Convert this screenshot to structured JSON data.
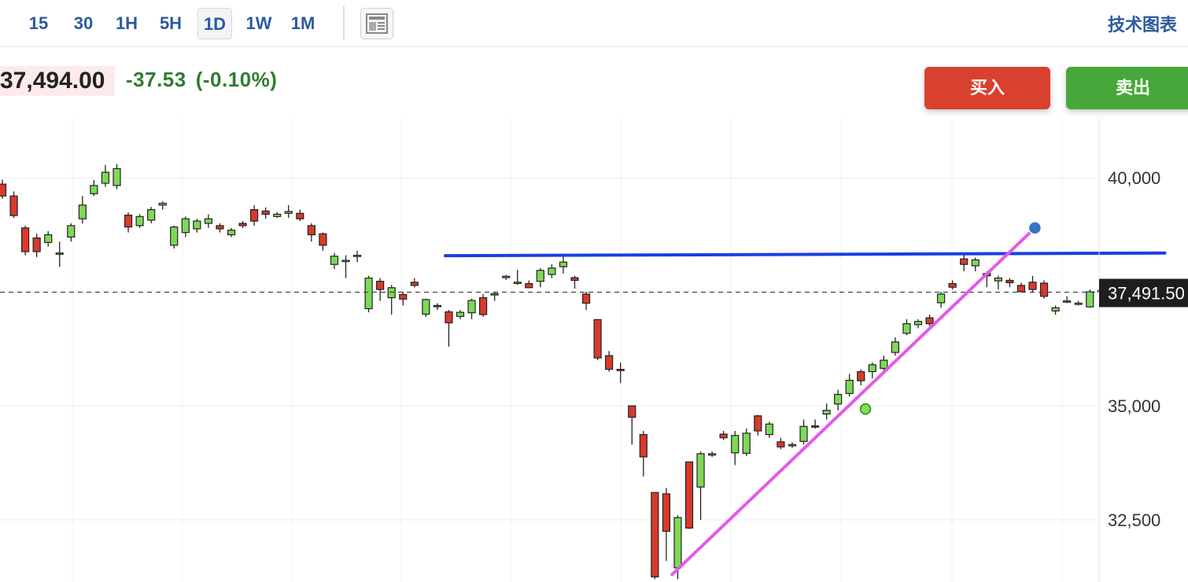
{
  "toolbar": {
    "timeframes": [
      "15",
      "30",
      "1H",
      "5H",
      "1D",
      "1W",
      "1M"
    ],
    "active_timeframe": "1D",
    "layout_icon": "layout-icon",
    "technical_link": "技术图表"
  },
  "quote": {
    "price": "37,494.00",
    "change": "-37.53",
    "change_pct": "(-0.10%)"
  },
  "actions": {
    "buy": "买入",
    "sell": "卖出"
  },
  "colors": {
    "up": "#7ed957",
    "down": "#d83a2c",
    "horizontal_line": "#1a3fe0",
    "trend_line": "#e35be8",
    "price_tag_bg": "#1e1e1e",
    "handle_blue": "#3a72c9",
    "handle_green": "#7ee04a"
  },
  "chart_data": {
    "type": "candlestick",
    "y_ticks": [
      {
        "value": 40000,
        "label": "40,000"
      },
      {
        "value": 35000,
        "label": "35,000"
      },
      {
        "value": 32500,
        "label": "32,500"
      }
    ],
    "ylim": [
      31300,
      41300
    ],
    "last_price": 37491.5,
    "last_price_label": "37,491.50",
    "horizontal_line": {
      "from_index": 40,
      "to_index": 101,
      "value": 38290,
      "end_value": 38350
    },
    "trend_line": {
      "from_index": 58.5,
      "to_index": 90.2,
      "from_value": 31300,
      "to_value": 38900
    },
    "trend_handles": [
      {
        "index": 90.2,
        "value": 38900,
        "color": "blue"
      },
      {
        "index": 75.4,
        "value": 34930,
        "color": "green"
      }
    ],
    "candles": [
      [
        39860,
        39600,
        39960,
        39540
      ],
      [
        39600,
        39170,
        39700,
        39120
      ],
      [
        38900,
        38380,
        38950,
        38300
      ],
      [
        38680,
        38380,
        38770,
        38260
      ],
      [
        38580,
        38750,
        38830,
        38490
      ],
      [
        38330,
        38350,
        38600,
        38050
      ],
      [
        38700,
        38950,
        39000,
        38600
      ],
      [
        39100,
        39400,
        39600,
        39000
      ],
      [
        39650,
        39830,
        39950,
        39600
      ],
      [
        39880,
        40120,
        40280,
        39800
      ],
      [
        39830,
        40200,
        40300,
        39750
      ],
      [
        39180,
        38920,
        39240,
        38800
      ],
      [
        38950,
        39150,
        39200,
        38900
      ],
      [
        39070,
        39300,
        39360,
        39000
      ],
      [
        39400,
        39440,
        39480,
        39300
      ],
      [
        38520,
        38920,
        38950,
        38450
      ],
      [
        38800,
        39100,
        39150,
        38700
      ],
      [
        38880,
        39050,
        39100,
        38800
      ],
      [
        39000,
        39100,
        39200,
        38900
      ],
      [
        38950,
        38880,
        39000,
        38800
      ],
      [
        38750,
        38850,
        38900,
        38700
      ],
      [
        39000,
        38950,
        39050,
        38900
      ],
      [
        39300,
        39050,
        39400,
        38950
      ],
      [
        39270,
        39200,
        39350,
        39100
      ],
      [
        39150,
        39200,
        39250,
        39120
      ],
      [
        39220,
        39260,
        39400,
        39120
      ],
      [
        39220,
        39100,
        39300,
        39050
      ],
      [
        38950,
        38750,
        39000,
        38600
      ],
      [
        38770,
        38520,
        38800,
        38400
      ],
      [
        38100,
        38280,
        38350,
        38000
      ],
      [
        38180,
        38190,
        38300,
        37800
      ],
      [
        38290,
        38300,
        38400,
        38150
      ],
      [
        37130,
        37800,
        37850,
        37050
      ],
      [
        37730,
        37550,
        37800,
        37300
      ],
      [
        37370,
        37590,
        37650,
        37000
      ],
      [
        37440,
        37340,
        37500,
        37200
      ],
      [
        37710,
        37640,
        37800,
        37600
      ],
      [
        37010,
        37330,
        37350,
        36950
      ],
      [
        37200,
        37180,
        37250,
        37100
      ],
      [
        37060,
        36820,
        37100,
        36300
      ],
      [
        36960,
        37050,
        37100,
        36900
      ],
      [
        37040,
        37310,
        37350,
        36900
      ],
      [
        37370,
        37000,
        37450,
        36950
      ],
      [
        37430,
        37460,
        37500,
        37300
      ],
      [
        37810,
        37840,
        37870,
        37760
      ],
      [
        37710,
        37710,
        37980,
        37650
      ],
      [
        37680,
        37590,
        37750,
        37580
      ],
      [
        37730,
        37970,
        38020,
        37600
      ],
      [
        37880,
        38020,
        38100,
        37800
      ],
      [
        38050,
        38150,
        38300,
        37900
      ],
      [
        37810,
        37750,
        37850,
        37570
      ],
      [
        37450,
        37250,
        37500,
        37100
      ],
      [
        36890,
        36050,
        36900,
        36000
      ],
      [
        36100,
        35800,
        36200,
        35750
      ],
      [
        35800,
        35780,
        35950,
        35500
      ],
      [
        35000,
        34750,
        35000,
        34150
      ],
      [
        34370,
        33880,
        34450,
        33450
      ],
      [
        33100,
        31250,
        33100,
        31200
      ],
      [
        33070,
        32250,
        33200,
        31600
      ],
      [
        31450,
        32550,
        32600,
        31200
      ],
      [
        33770,
        32320,
        33770,
        32300
      ],
      [
        33220,
        33950,
        34000,
        32500
      ],
      [
        33920,
        33950,
        34000,
        33880
      ],
      [
        34380,
        34300,
        34450,
        34250
      ],
      [
        33970,
        34350,
        34450,
        33700
      ],
      [
        33960,
        34400,
        34500,
        33900
      ],
      [
        34780,
        34450,
        34800,
        34350
      ],
      [
        34370,
        34600,
        34650,
        34300
      ],
      [
        34210,
        34100,
        34300,
        34050
      ],
      [
        34140,
        34150,
        34200,
        34080
      ],
      [
        34220,
        34550,
        34700,
        34150
      ],
      [
        34560,
        34550,
        34700,
        34500
      ],
      [
        34820,
        34900,
        35050,
        34700
      ],
      [
        35040,
        35250,
        35350,
        34900
      ],
      [
        35270,
        35560,
        35700,
        35200
      ],
      [
        35750,
        35550,
        35800,
        35450
      ],
      [
        35750,
        35900,
        35950,
        35600
      ],
      [
        35820,
        36000,
        36100,
        35700
      ],
      [
        36170,
        36400,
        36500,
        36100
      ],
      [
        36590,
        36800,
        36900,
        36550
      ],
      [
        36780,
        36850,
        36900,
        36700
      ],
      [
        36930,
        36800,
        37000,
        36750
      ],
      [
        37260,
        37450,
        37500,
        37150
      ],
      [
        37680,
        37600,
        37750,
        37550
      ],
      [
        38220,
        38100,
        38350,
        37950
      ],
      [
        38070,
        38200,
        38250,
        37950
      ],
      [
        37900,
        37850,
        37950,
        37600
      ],
      [
        37740,
        37800,
        37850,
        37550
      ],
      [
        37750,
        37700,
        37800,
        37600
      ],
      [
        37640,
        37500,
        37700,
        37500
      ],
      [
        37710,
        37550,
        37850,
        37500
      ],
      [
        37690,
        37400,
        37750,
        37350
      ],
      [
        37080,
        37150,
        37200,
        37000
      ],
      [
        37300,
        37300,
        37400,
        37250
      ],
      [
        37230,
        37250,
        37300,
        37200
      ],
      [
        37170,
        37500,
        37550,
        37150
      ],
      [
        37530,
        37500,
        37550,
        37480
      ]
    ]
  }
}
